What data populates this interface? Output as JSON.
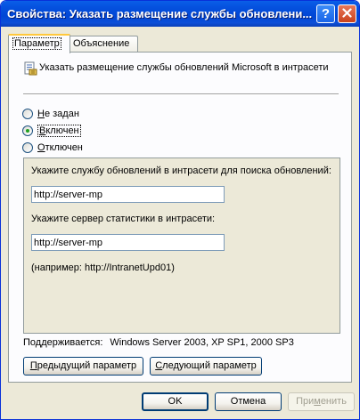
{
  "window": {
    "title": "Свойства: Указать размещение службы обновлени...",
    "help_glyph": "?",
    "close_glyph": "✕"
  },
  "tabs": [
    {
      "label": "Параметр",
      "active": true
    },
    {
      "label": "Объяснение",
      "active": false
    }
  ],
  "policy": {
    "icon": "policy-setting-icon",
    "title": "Указать размещение службы обновлений Microsoft в интрасети"
  },
  "options": [
    {
      "hotkey": "Н",
      "rest": "е задан",
      "selected": false
    },
    {
      "hotkey": "В",
      "rest": "ключен",
      "selected": true
    },
    {
      "hotkey": "О",
      "rest": "тключен",
      "selected": false
    }
  ],
  "settings": {
    "update_service_label": "Укажите службу обновлений в интрасети для поиска обновлений:",
    "update_service_value": "http://server-mp",
    "stats_server_label": "Укажите сервер статистики в интрасети:",
    "stats_server_value": "http://server-mp",
    "example": "(например: http://IntranetUpd01)"
  },
  "supported": {
    "label": "Поддерживается:",
    "value": "Windows Server 2003, XP SP1, 2000 SP3"
  },
  "nav_buttons": {
    "prev_hotkey": "П",
    "prev_rest": "редыдущий параметр",
    "next_hotkey": "С",
    "next_rest": "ледующий параметр"
  },
  "dialog_buttons": {
    "ok": "OK",
    "cancel": "Отмена",
    "apply_before": "При",
    "apply_hotkey": "м",
    "apply_after": "енить"
  },
  "colors": {
    "titlebar": "#0054e3",
    "dialog_bg": "#ece9d8",
    "active_tab_accent": "#ffc83c",
    "radio_checked": "#21a121"
  }
}
